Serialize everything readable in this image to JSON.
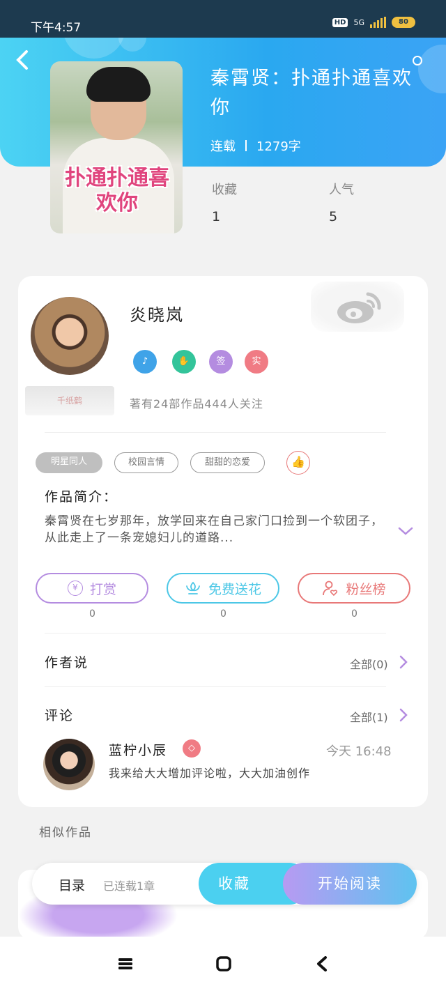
{
  "status_bar": {
    "time": "下午4:57",
    "hd": "HD",
    "network": "5G",
    "battery": "80"
  },
  "book": {
    "title": "秦霄贤：扑通扑通喜欢你",
    "cover_title": "扑通扑通喜欢你",
    "status": "连载",
    "word_count": "1279字",
    "stats": [
      {
        "label": "收藏",
        "value": "1"
      },
      {
        "label": "人气",
        "value": "5"
      }
    ]
  },
  "author": {
    "name": "炎晓岚",
    "badges": [
      {
        "icon": "music-note-icon",
        "color": "#3fa3e8"
      },
      {
        "icon": "handshake-icon",
        "color": "#33c49a"
      },
      {
        "text": "签",
        "color": "#b48ce0"
      },
      {
        "text": "实",
        "color": "#f07b84"
      }
    ],
    "stamp": "千纸鹤",
    "meta": "著有24部作品444人关注"
  },
  "tags": [
    "明星同人",
    "校园言情",
    "甜甜的恋爱"
  ],
  "intro": {
    "label": "作品简介：",
    "text": "秦霄贤在七岁那年，放学回来在自己家门口捡到一个软团子，从此走上了一条宠媳妇儿的道路..."
  },
  "actions": [
    {
      "label": "打赏",
      "icon": "¥",
      "color": "#b48ce0",
      "count": "0"
    },
    {
      "label": "免费送花",
      "icon": "flower-icon",
      "color": "#4cc7e6",
      "count": "0"
    },
    {
      "label": "粉丝榜",
      "icon": "user-heart-icon",
      "color": "#e87878",
      "count": "0"
    }
  ],
  "author_says": {
    "title": "作者说",
    "link": "全部(0)"
  },
  "comments": {
    "title": "评论",
    "link": "全部(1)",
    "items": [
      {
        "name": "蓝柠小辰",
        "time": "今天 16:48",
        "text": "我来给大大增加评论啦，大大加油创作"
      }
    ]
  },
  "similar": {
    "title": "相似作品"
  },
  "bottom_bar": {
    "catalog": "目录",
    "serial": "已连载1章",
    "collect": "收藏",
    "read": "开始阅读"
  }
}
